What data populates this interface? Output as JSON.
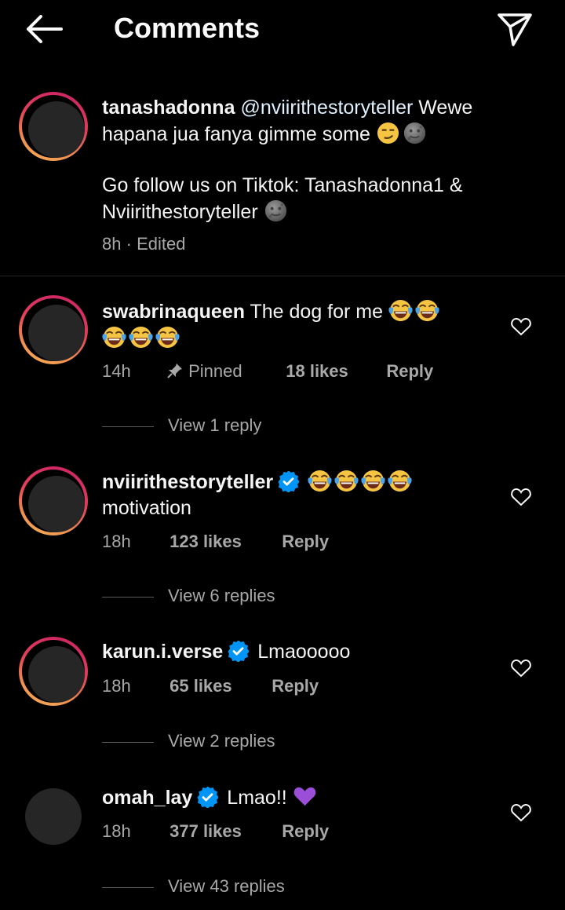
{
  "header": {
    "title": "Comments",
    "back_icon": "arrow-left-icon",
    "share_icon": "paper-plane-icon"
  },
  "caption": {
    "username": "tanashadonna",
    "mention": "@nviirithestoryteller",
    "text_line1": " Wewe hapana jua fanya gimme some ",
    "text_line2": "Go follow us on Tiktok: Tanashadonna1 & Nviirithestoryteller ",
    "time": "8h",
    "separator": "·",
    "edited": "Edited"
  },
  "comments": [
    {
      "username": "swabrinaqueen",
      "text": " The dog for me ",
      "time": "14h",
      "pinned": "Pinned",
      "likes": "18 likes",
      "reply": "Reply",
      "view_replies": "View 1 reply"
    },
    {
      "username": "nviirithestoryteller",
      "text": "motivation",
      "time": "18h",
      "likes": "123 likes",
      "reply": "Reply",
      "view_replies": "View 6 replies"
    },
    {
      "username": "karun.i.verse",
      "text": "Lmaooooo",
      "time": "18h",
      "likes": "65 likes",
      "reply": "Reply",
      "view_replies": "View 2 replies"
    },
    {
      "username": "omah_lay",
      "text": "Lmao!! ",
      "time": "18h",
      "likes": "377 likes",
      "reply": "Reply",
      "view_replies": "View 43 replies"
    }
  ],
  "colors": {
    "background": "#000000",
    "text": "#f5f5f5",
    "secondary": "#a8a8a8",
    "verified": "#0095f6",
    "story_ring_start": "#c81f69",
    "story_ring_end": "#f7b35a"
  }
}
